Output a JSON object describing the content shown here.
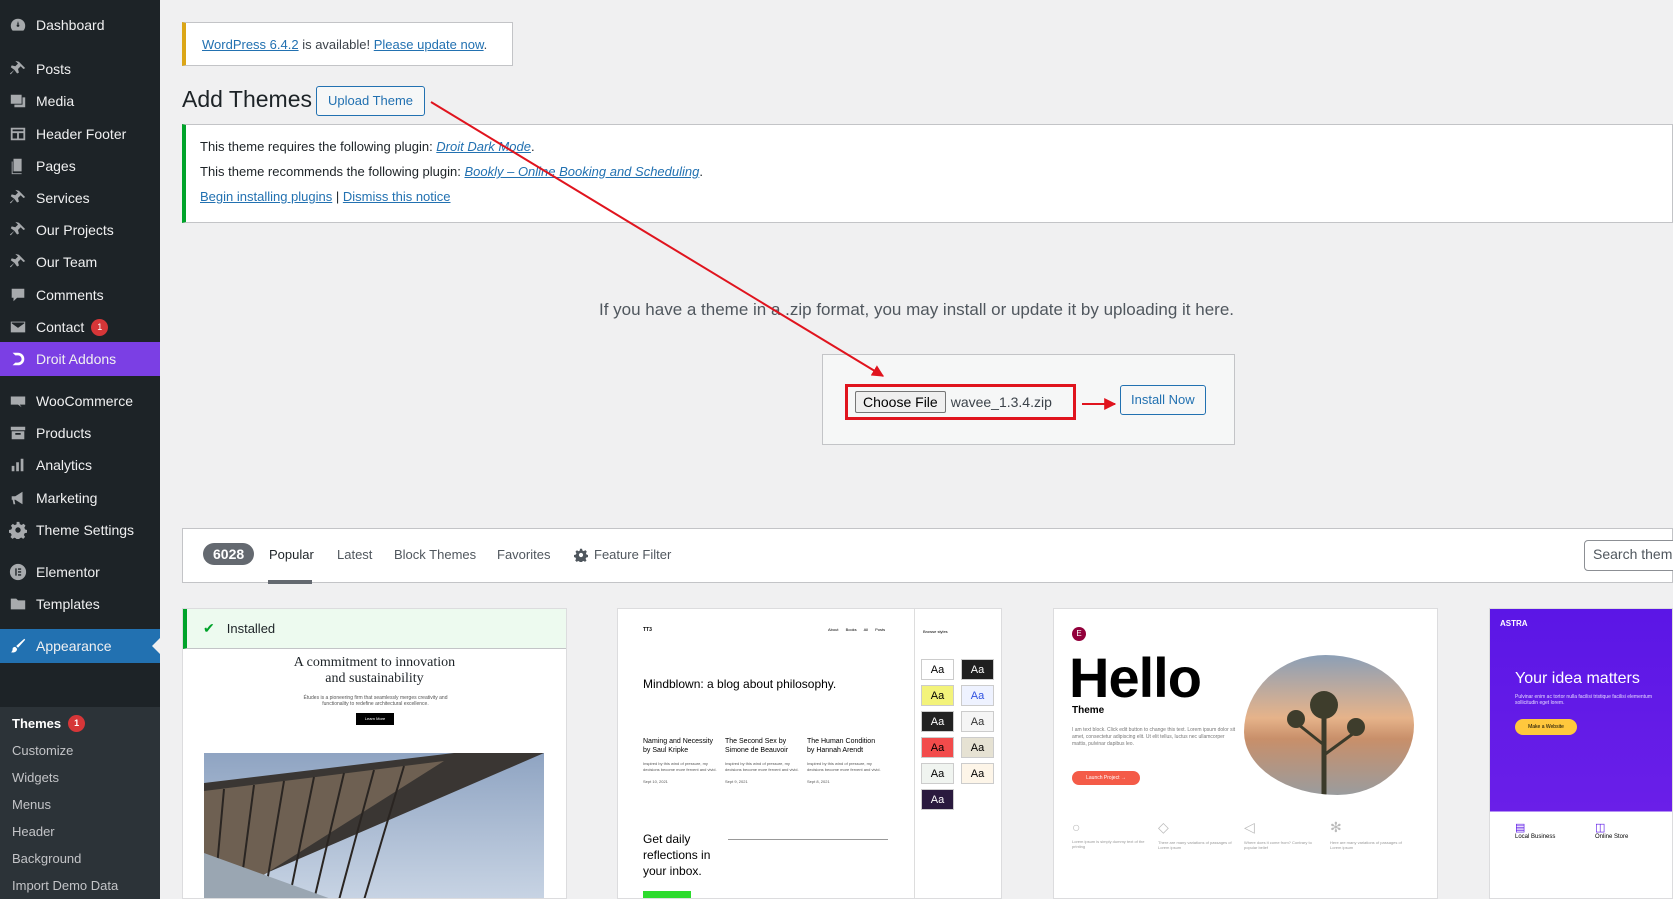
{
  "sidebar": {
    "items": [
      {
        "label": "Dashboard",
        "icon": "dashboard-icon"
      },
      {
        "label": "Posts",
        "icon": "pin-icon"
      },
      {
        "label": "Media",
        "icon": "media-icon"
      },
      {
        "label": "Header Footer",
        "icon": "layout-icon"
      },
      {
        "label": "Pages",
        "icon": "pages-icon"
      },
      {
        "label": "Services",
        "icon": "pin-icon"
      },
      {
        "label": "Our Projects",
        "icon": "pin-icon"
      },
      {
        "label": "Our Team",
        "icon": "pin-icon"
      },
      {
        "label": "Comments",
        "icon": "comment-icon"
      },
      {
        "label": "Contact",
        "icon": "mail-icon",
        "badge": "1"
      },
      {
        "label": "Droit Addons",
        "icon": "droit-icon"
      },
      {
        "label": "WooCommerce",
        "icon": "woo-icon"
      },
      {
        "label": "Products",
        "icon": "archive-icon"
      },
      {
        "label": "Analytics",
        "icon": "bar-chart-icon"
      },
      {
        "label": "Marketing",
        "icon": "megaphone-icon"
      },
      {
        "label": "Theme Settings",
        "icon": "gear-icon"
      },
      {
        "label": "Elementor",
        "icon": "elementor-icon"
      },
      {
        "label": "Templates",
        "icon": "folder-icon"
      },
      {
        "label": "Appearance",
        "icon": "brush-icon"
      }
    ],
    "submenu": [
      {
        "label": "Themes",
        "badge": "1"
      },
      {
        "label": "Customize"
      },
      {
        "label": "Widgets"
      },
      {
        "label": "Menus"
      },
      {
        "label": "Header"
      },
      {
        "label": "Background"
      },
      {
        "label": "Import Demo Data"
      }
    ]
  },
  "nag": {
    "version_link": "WordPress 6.4.2",
    "middle": " is available! ",
    "update_link": "Please update now",
    "end": "."
  },
  "page": {
    "title": "Add Themes",
    "upload_button": "Upload Theme"
  },
  "notice": {
    "line1_prefix": "This theme requires the following plugin: ",
    "line1_link": "Droit Dark Mode",
    "line2_prefix": "This theme recommends the following plugin: ",
    "line2_link": "Bookly – Online Booking and Scheduling",
    "begin_link": "Begin installing plugins",
    "separator": " | ",
    "dismiss_link": "Dismiss this notice",
    "period": "."
  },
  "upload": {
    "message": "If you have a theme in a .zip format, you may install or update it by uploading it here.",
    "choose_button": "Choose File",
    "file_name": "wavee_1.3.4.zip",
    "install_button": "Install Now"
  },
  "filter": {
    "count": "6028",
    "tabs": [
      "Popular",
      "Latest",
      "Block Themes",
      "Favorites"
    ],
    "feature_filter": "Feature Filter",
    "search_placeholder": "Search themes..."
  },
  "themes": {
    "card1": {
      "installed": "Installed",
      "heading": "A commitment to innovation and sustainability",
      "paragraph": "Études is a pioneering firm that seamlessly merges creativity and functionality to redefine architectural excellence.",
      "button": "Learn More"
    },
    "card2": {
      "logo": "TT3",
      "nav": "About  Books  All Posts",
      "heading": "Mindblown: a blog about philosophy.",
      "col1_title": "Naming and Necessity by Saul Kripke",
      "col2_title": "The Second Sex by Simone de Beauvoir",
      "col3_title": "The Human Condition by Hannah Arendt",
      "col_text": "Inspired by this wind of pressure, my decisions become more fervent and vivid.",
      "col1_date": "Sept 10, 2021",
      "col2_date": "Sept 9, 2021",
      "col3_date": "Sept 8, 2021",
      "subheading": "Get daily reflections in your inbox.",
      "swatch_label": "Aa",
      "panel_title": "Browse styles"
    },
    "card3": {
      "icon": "E",
      "hello": "Hello",
      "theme_label": "Theme",
      "paragraph": "I am text block. Click edit button to change this text. Lorem ipsum dolor sit amet, consectetur adipiscing elit. Ut elit tellus, luctus nec ullamcorper mattis, pulvinar dapibus leo.",
      "button": "Launch Project →",
      "feat1": "Lorem ipsum is simply dummy text of the printing",
      "feat2": "There are many variations of passages of Lorem ipsum",
      "feat3": "Where does it come from? Contrary to popular belief",
      "feat4": "Here are many variations of passages of Lorem ipsum"
    },
    "card4": {
      "logo": "ASTRA",
      "heading": "Your idea matters",
      "paragraph": "Pulvinar enim ac tortor nulla facilisi tristique facilisi elementum sollicitudin eget lorem.",
      "button": "Make a Website",
      "feat1": "Local Business",
      "feat2": "Online Store"
    }
  },
  "colors": {
    "sidebar_bg": "#1d2327",
    "droit_highlight": "#7b3fe4",
    "appearance_highlight": "#2271b1",
    "annotation_red": "#e0141e"
  }
}
